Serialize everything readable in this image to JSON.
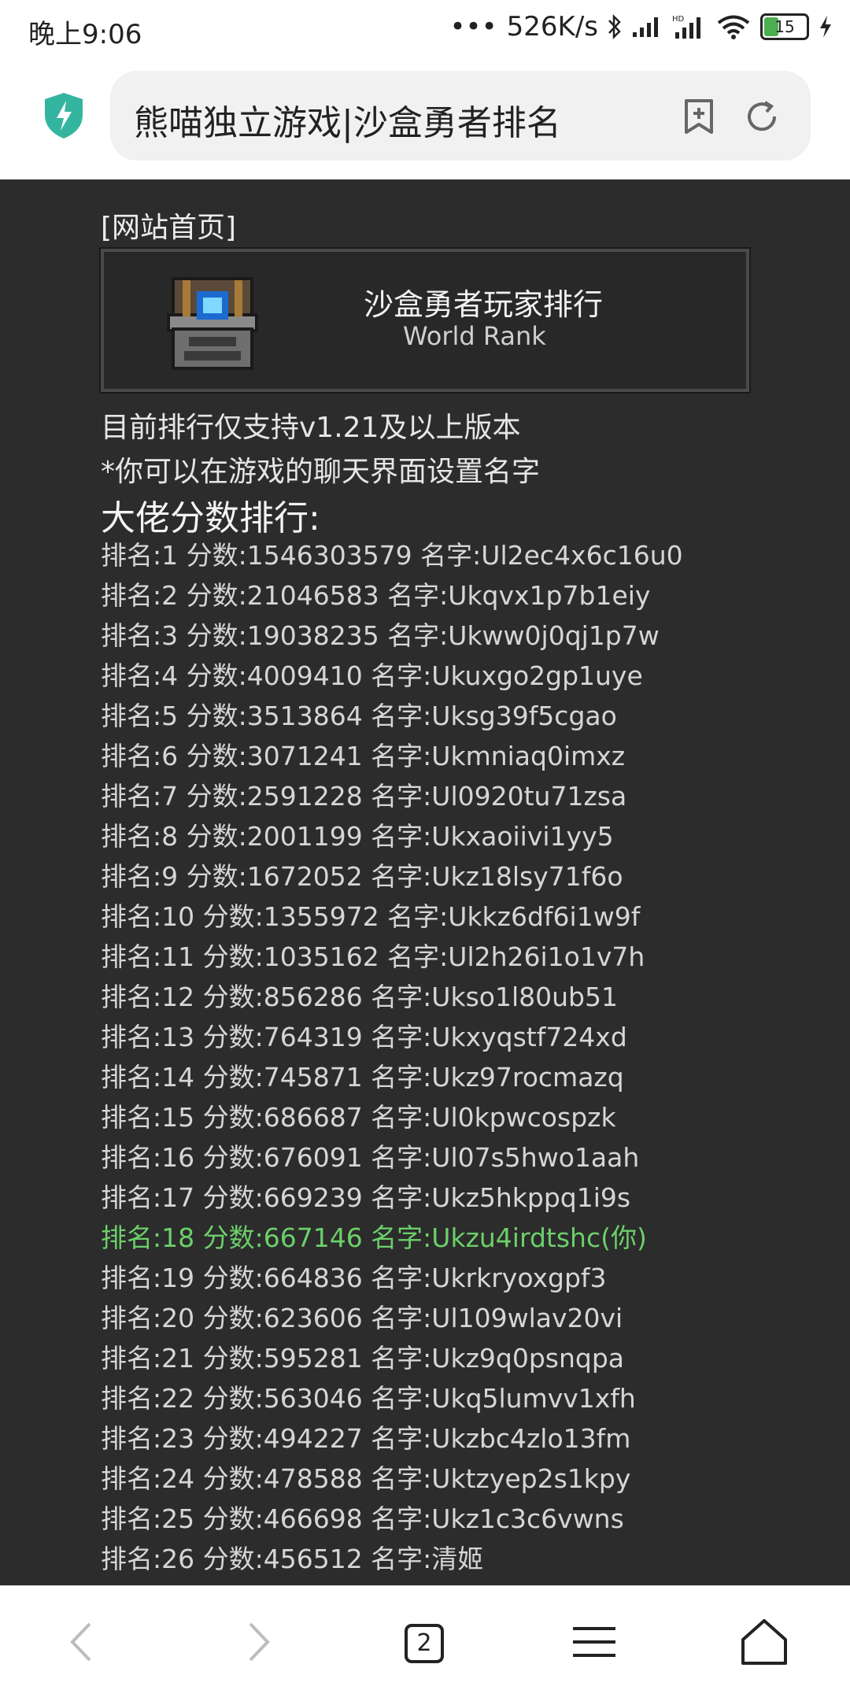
{
  "status_bar": {
    "time": "晚上9:06",
    "network_speed": "526K/s",
    "battery": "15",
    "icons": [
      "bluetooth-icon",
      "signal-icon",
      "hd-signal-icon",
      "wifi-icon",
      "battery-icon",
      "charging-icon"
    ]
  },
  "browser": {
    "page_title": "熊喵独立游戏|沙盒勇者排名",
    "tab_count": "2",
    "icons": [
      "shield-icon",
      "add-bookmark-icon",
      "reload-icon",
      "back-icon",
      "forward-icon",
      "menu-icon",
      "home-icon"
    ]
  },
  "page": {
    "home_link": "[网站首页]",
    "banner": {
      "title": "沙盒勇者玩家排行",
      "subtitle": "World Rank"
    },
    "note1": "目前排行仅支持v1.21及以上版本",
    "note2": "*你可以在游戏的聊天界面设置名字",
    "heading": "大佬分数排行:",
    "rankings": [
      "排名:1 分数:1546303579 名字:Ul2ec4x6c16u0",
      "排名:2 分数:21046583 名字:Ukqvx1p7b1eiy",
      "排名:3 分数:19038235 名字:Ukww0j0qj1p7w",
      "排名:4 分数:4009410 名字:Ukuxgo2gp1uye",
      "排名:5 分数:3513864 名字:Uksg39f5cgao",
      "排名:6 分数:3071241 名字:Ukmniaq0imxz",
      "排名:7 分数:2591228 名字:Ul0920tu71zsa",
      "排名:8 分数:2001199 名字:Ukxaoiivi1yy5",
      "排名:9 分数:1672052 名字:Ukz18lsy71f6o",
      "排名:10 分数:1355972 名字:Ukkz6df6i1w9f",
      "排名:11 分数:1035162 名字:Ul2h26i1o1v7h",
      "排名:12 分数:856286 名字:Ukso1l80ub51",
      "排名:13 分数:764319 名字:Ukxyqstf724xd",
      "排名:14 分数:745871 名字:Ukz97rocmazq",
      "排名:15 分数:686687 名字:Ul0kpwcospzk",
      "排名:16 分数:676091 名字:Ul07s5hwo1aah",
      "排名:17 分数:669239 名字:Ukz5hkppq1i9s",
      "排名:18 分数:667146 名字:Ukzu4irdtshc(你)",
      "排名:19 分数:664836 名字:Ukrkryoxgpf3",
      "排名:20 分数:623606 名字:Ul109wlav20vi",
      "排名:21 分数:595281 名字:Ukz9q0psnqpa",
      "排名:22 分数:563046 名字:Ukq5lumvv1xfh",
      "排名:23 分数:494227 名字:Ukzbc4zlo13fm",
      "排名:24 分数:478588 名字:Uktzyep2s1kpy",
      "排名:25 分数:466698 名字:Ukz1c3c6vwns",
      "排名:26 分数:456512 名字:清姬"
    ],
    "highlight_color": "#6ccf6a"
  }
}
